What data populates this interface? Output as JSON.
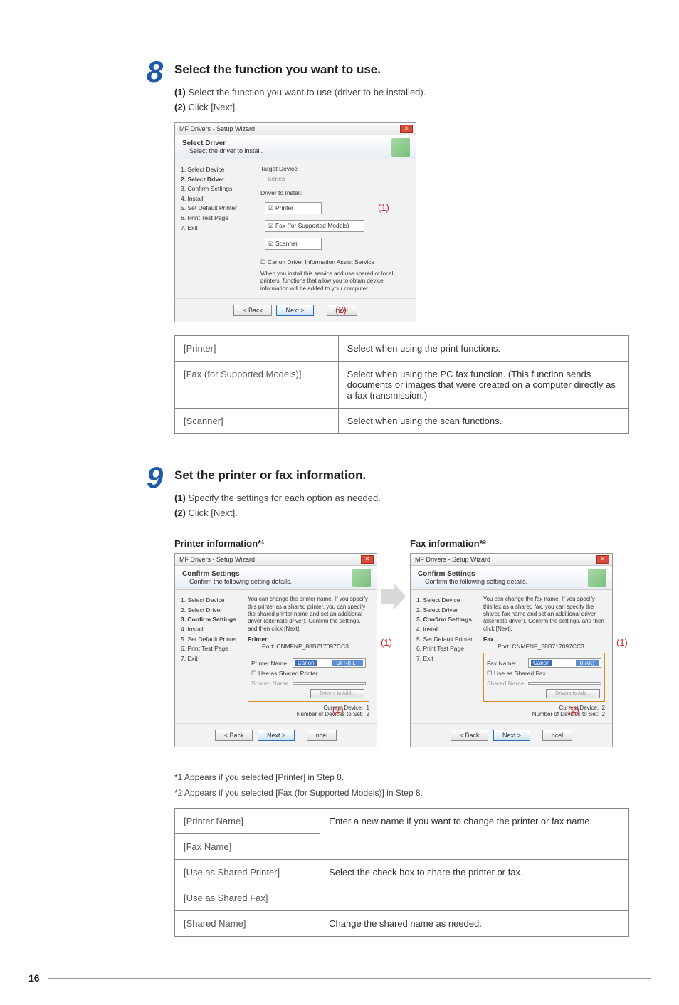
{
  "page_number": "16",
  "step8": {
    "num": "8",
    "title": "Select the function you want to use.",
    "sub1_b": "(1)",
    "sub1": " Select the function you want to use (driver to be installed).",
    "sub2_b": "(2)",
    "sub2": " Click [Next].",
    "dialog": {
      "title": "MF Drivers - Setup Wizard",
      "hdr_b": "Select Driver",
      "hdr_line": "Select the driver to install.",
      "steps": [
        "1.  Select Device",
        "2.  Select Driver",
        "3.  Confirm Settings",
        "4.  Install",
        "5.  Set Default Printer",
        "6.  Print Test Page",
        "7.  Exit"
      ],
      "target": "Target Device",
      "series": "Series",
      "driver_lbl": "Driver to Install:",
      "c1": "☑ Printer",
      "c2": "☑ Fax (for Supported Models)",
      "c3": "☑ Scanner",
      "c4": "☐ Canon Driver Information Assist Service",
      "svc": "When you install this service and use shared or local printers, functions that allow you to obtain device information will be added to your computer.",
      "back": "< Back",
      "next": "Next >",
      "cancel": "ncel",
      "a1": "(1)",
      "a2": "(2)"
    },
    "table": [
      {
        "k": "[Printer]",
        "v": "Select when using the print functions."
      },
      {
        "k": "[Fax (for Supported Models)]",
        "v": "Select when using the PC fax function. (This function sends documents or images that were created on a computer directly as a fax transmission.)"
      },
      {
        "k": "[Scanner]",
        "v": "Select when using the scan functions."
      }
    ]
  },
  "step9": {
    "num": "9",
    "title": "Set the printer or fax information.",
    "sub1_b": "(1)",
    "sub1": " Specify the settings for each option as needed.",
    "sub2_b": "(2)",
    "sub2": " Click [Next].",
    "h_left": "Printer information*¹",
    "h_right": "Fax information*²",
    "dialogL": {
      "title": "MF Drivers - Setup Wizard",
      "hdr_b": "Confirm Settings",
      "hdr_line": "Confirm the following setting details.",
      "steps": [
        "1.  Select Device",
        "2.  Select Driver",
        "3.  Confirm Settings",
        "4.  Install",
        "5.  Set Default Printer",
        "6.  Print Test Page",
        "7.  Exit"
      ],
      "intro": "You can change the printer name. If you specify this printer as a shared printer, you can specify the shared printer name and set an additional driver (alternate driver). Confirm the settings, and then click [Next].",
      "kind": "Printer",
      "port": "Port:  CNMFNP_88B717097CC3",
      "name_l": "Printer Name:",
      "name_v1": "Canon",
      "name_v2": "UFRII LT",
      "share": "☐ Use as Shared Printer",
      "shared": "Shared Name",
      "cur": "Current Device:",
      "curv": "1",
      "nds": "Number of Devices to Set:",
      "ndsv": "2",
      "back": "< Back",
      "next": "Next >",
      "cancel": "ncel",
      "a1": "(1)",
      "a2": "(2)"
    },
    "dialogR": {
      "title": "MF Drivers - Setup Wizard",
      "hdr_b": "Confirm Settings",
      "hdr_line": "Confirm the following setting details.",
      "steps": [
        "1.  Select Device",
        "2.  Select Driver",
        "3.  Confirm Settings",
        "4.  Install",
        "5.  Set Default Printer",
        "6.  Print Test Page",
        "7.  Exit"
      ],
      "intro": "You can change the fax name. If you specify this fax as a shared fax, you can specify the shared fax name and set an additional driver (alternate driver). Confirm the settings, and then click [Next].",
      "kind": "Fax",
      "port": "Port:  CNMFNP_88B717097CC3",
      "name_l": "Fax Name:",
      "name_v1": "Canon",
      "name_v2": "(FAX)",
      "share": "☐ Use as Shared Fax",
      "shared": "Shared Name",
      "cur": "Current Device:",
      "curv": "2",
      "nds": "Number of Devices to Set:",
      "ndsv": "2",
      "back": "< Back",
      "next": "Next >",
      "cancel": "ncel",
      "a1": "(1)",
      "a2": "(2)"
    },
    "note1": "*1  Appears if you selected [Printer] in Step 8.",
    "note2": "*2  Appears if you selected [Fax (for Supported Models)] in Step 8.",
    "table2": [
      {
        "k": "[Printer Name]",
        "v": "Enter a new name if you want to change the printer or fax name."
      },
      {
        "k": "[Fax Name]",
        "v": ""
      },
      {
        "k": "[Use as Shared Printer]",
        "v": "Select the check box to share the printer or fax."
      },
      {
        "k": "[Use as Shared Fax]",
        "v": ""
      },
      {
        "k": "[Shared Name]",
        "v": "Change the shared name as needed."
      }
    ]
  }
}
